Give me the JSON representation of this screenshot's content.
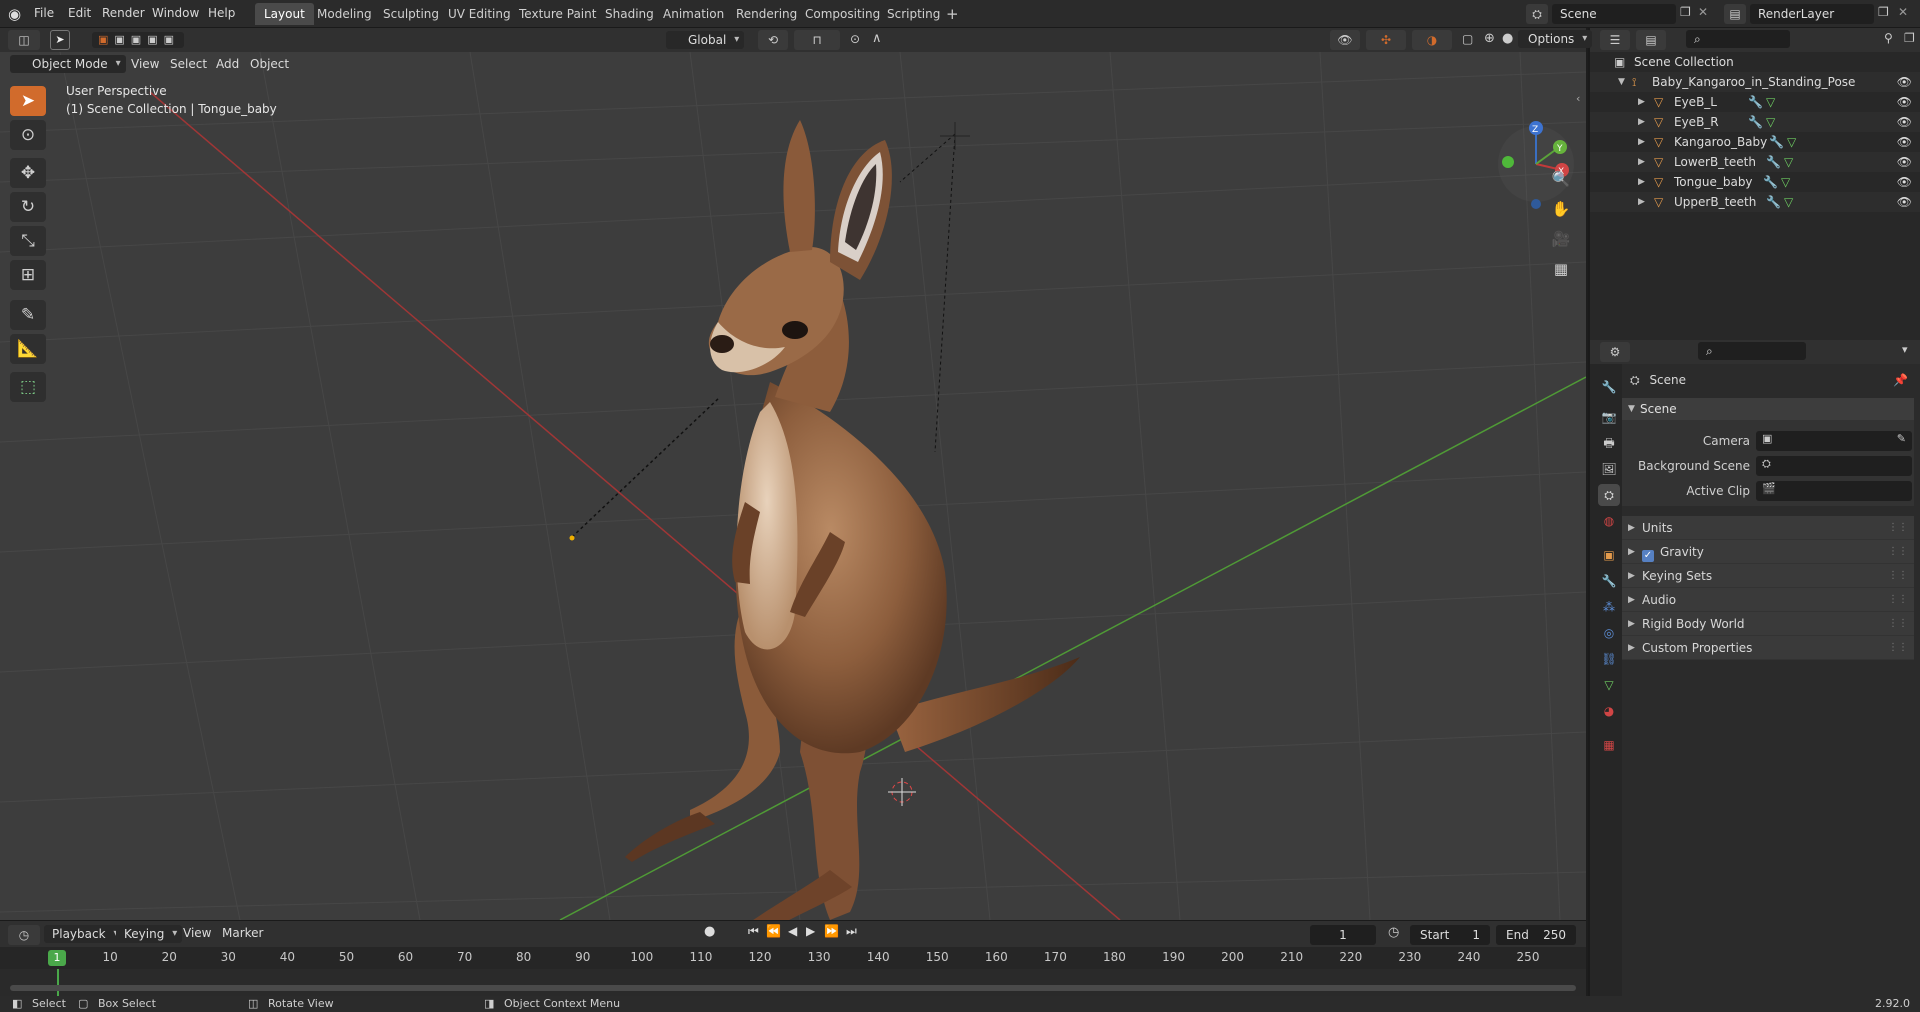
{
  "topbar": {
    "menus": [
      "File",
      "Edit",
      "Render",
      "Window",
      "Help"
    ],
    "workspaces": [
      "Layout",
      "Modeling",
      "Sculpting",
      "UV Editing",
      "Texture Paint",
      "Shading",
      "Animation",
      "Rendering",
      "Compositing",
      "Scripting"
    ],
    "active_workspace": "Layout",
    "scene_name": "Scene",
    "view_layer": "RenderLayer"
  },
  "viewport_header": {
    "mode": "Object Mode",
    "menus": [
      "View",
      "Select",
      "Add",
      "Object"
    ],
    "orientation": "Global",
    "options_label": "Options"
  },
  "viewport": {
    "perspective_label": "User Perspective",
    "collection_label": "(1) Scene Collection | Tongue_baby",
    "gizmo_axes": [
      "Z",
      "Y",
      "X"
    ],
    "colors": {
      "background": "#3d3d3d",
      "x_axis": "#b33a3a",
      "y_axis": "#5aa33a",
      "accent": "#d16b2c"
    }
  },
  "outliner": {
    "root": "Scene Collection",
    "collection": "Baby_Kangaroo_in_Standing_Pose",
    "objects": [
      "EyeB_L",
      "EyeB_R",
      "Kangaroo_Baby",
      "LowerB_teeth",
      "Tongue_baby",
      "UpperB_teeth"
    ]
  },
  "properties": {
    "context_title": "Scene",
    "panel_title": "Scene",
    "fields": [
      {
        "label": "Camera"
      },
      {
        "label": "Background Scene"
      },
      {
        "label": "Active Clip"
      }
    ],
    "subpanels": [
      "Units",
      "Gravity",
      "Keying Sets",
      "Audio",
      "Rigid Body World",
      "Custom Properties"
    ],
    "gravity_checked": true
  },
  "timeline": {
    "menus": [
      "Playback",
      "Keying",
      "View",
      "Marker"
    ],
    "current_frame": "1",
    "start_label": "Start",
    "start_value": "1",
    "end_label": "End",
    "end_value": "250",
    "ruler_ticks": [
      "10",
      "20",
      "30",
      "40",
      "50",
      "60",
      "70",
      "80",
      "90",
      "100",
      "110",
      "120",
      "130",
      "140",
      "150",
      "160",
      "170",
      "180",
      "190",
      "200",
      "210",
      "220",
      "230",
      "240",
      "250"
    ],
    "playhead_label": "1"
  },
  "statusbar": {
    "select": "Select",
    "box_select": "Box Select",
    "rotate_view": "Rotate View",
    "context_menu": "Object Context Menu",
    "version": "2.92.0"
  }
}
